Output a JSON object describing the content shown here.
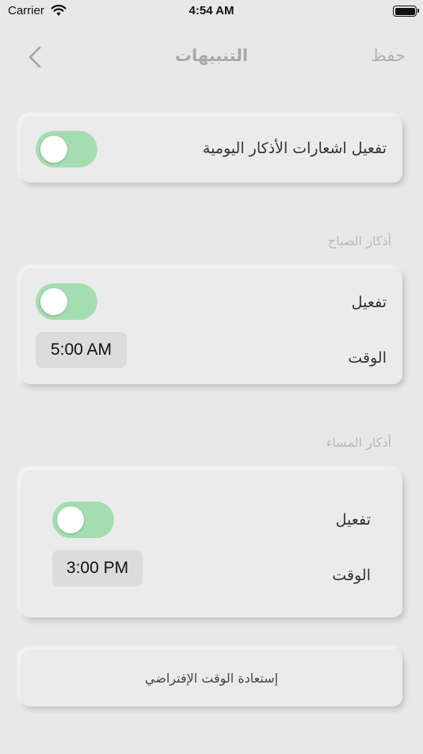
{
  "status_bar": {
    "carrier": "Carrier",
    "time": "4:54 AM"
  },
  "nav": {
    "title": "التنبيهات",
    "save_label": "حفظ"
  },
  "daily": {
    "label": "تفعيل اشعارات الأذكار اليومية",
    "enabled": true
  },
  "morning": {
    "header": "أذكار الصباح",
    "enable_label": "تفعيل",
    "enabled": true,
    "time_label": "الوقت",
    "time": "5:00 AM"
  },
  "evening": {
    "header": "أذكار المساء",
    "enable_label": "تفعيل",
    "enabled": true,
    "time_label": "الوقت",
    "time": "3:00 PM"
  },
  "restore": {
    "label": "إستعادة الوقت الإفتراضي"
  },
  "colors": {
    "background": "#e8e8e8",
    "toggle_on": "#a5ddb2",
    "time_pill": "#dcdcdc",
    "muted_text": "#b3b3b3"
  }
}
